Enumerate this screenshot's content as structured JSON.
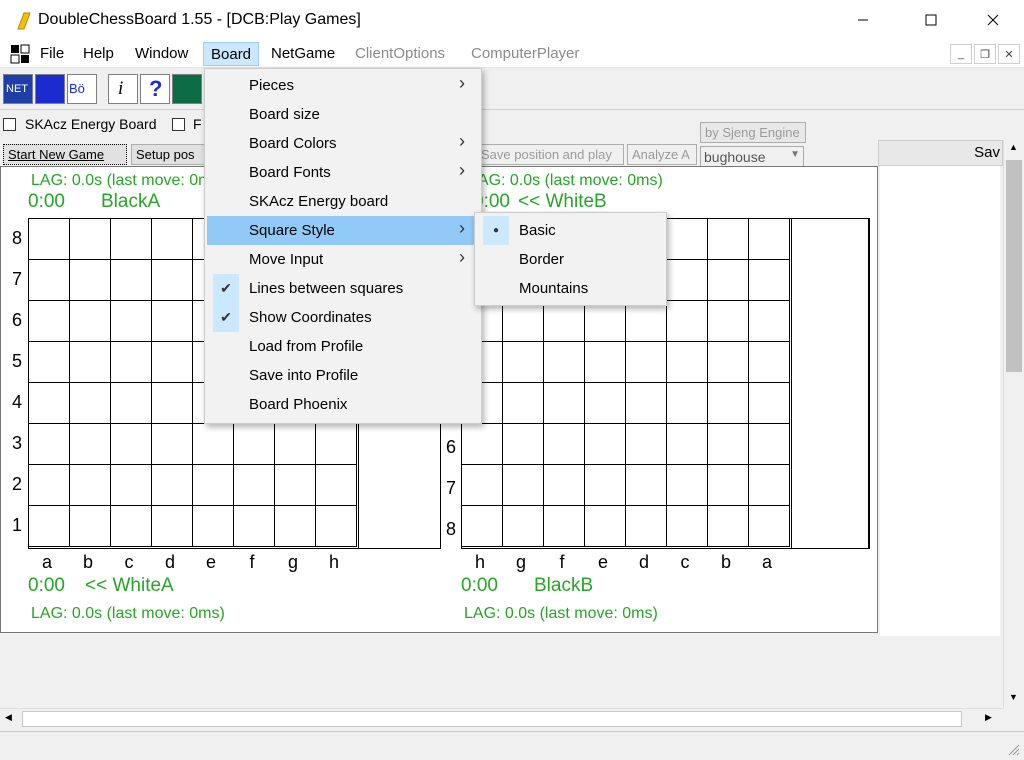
{
  "window": {
    "title": "DoubleChessBoard 1.55 - [DCB:Play Games]"
  },
  "menubar": {
    "items": [
      "File",
      "Help",
      "Window",
      "Board",
      "NetGame",
      "ClientOptions",
      "ComputerPlayer"
    ]
  },
  "options": {
    "skacz_label": "SKAcz Energy Board",
    "f_label": "F",
    "start_new_game": "Start New Game",
    "setup_pos": "Setup pos",
    "save_position": "Save position and play",
    "analyze": "Analyze A",
    "sjeng": "by Sjeng Engine",
    "variant": "bughouse",
    "save_right": "Sav"
  },
  "board_a": {
    "lag_top": "LAG: 0.0s (last move: 0ms)",
    "clock_top": "0:00",
    "name_top": "BlackA",
    "clock_bottom": "0:00",
    "name_bottom": "<< WhiteA",
    "lag_bottom": "LAG: 0.0s (last move: 0ms)",
    "ranks": [
      "8",
      "7",
      "6",
      "5",
      "4",
      "3",
      "2",
      "1"
    ],
    "files": [
      "a",
      "b",
      "c",
      "d",
      "e",
      "f",
      "g",
      "h"
    ]
  },
  "board_b": {
    "lag_top": "LAG: 0.0s (last move: 0ms)",
    "clock_top": "0:00",
    "name_top": "<< WhiteB",
    "clock_bottom": "0:00",
    "name_bottom": "BlackB",
    "lag_bottom": "LAG: 0.0s (last move: 0ms)",
    "ranks_visible": [
      "6",
      "7",
      "8"
    ],
    "files": [
      "h",
      "g",
      "f",
      "e",
      "d",
      "c",
      "b",
      "a"
    ]
  },
  "board_menu": {
    "items": [
      {
        "label": "Pieces",
        "submenu": true
      },
      {
        "label": "Board size"
      },
      {
        "label": "Board Colors",
        "submenu": true
      },
      {
        "label": "Board Fonts",
        "submenu": true
      },
      {
        "label": "SKAcz Energy board"
      },
      {
        "label": "Square Style",
        "submenu": true,
        "highlighted": true
      },
      {
        "label": "Move Input",
        "submenu": true
      },
      {
        "label": "Lines between squares",
        "checked": true
      },
      {
        "label": "Show Coordinates",
        "checked": true
      },
      {
        "label": "Load from Profile"
      },
      {
        "label": "Save into Profile"
      },
      {
        "label": "Board Phoenix"
      }
    ]
  },
  "square_style_menu": {
    "items": [
      {
        "label": "Basic",
        "selected": true
      },
      {
        "label": "Border"
      },
      {
        "label": "Mountains"
      }
    ]
  },
  "colors": {
    "clock_green": "#26a526",
    "menu_highlight": "#91c9f7"
  }
}
